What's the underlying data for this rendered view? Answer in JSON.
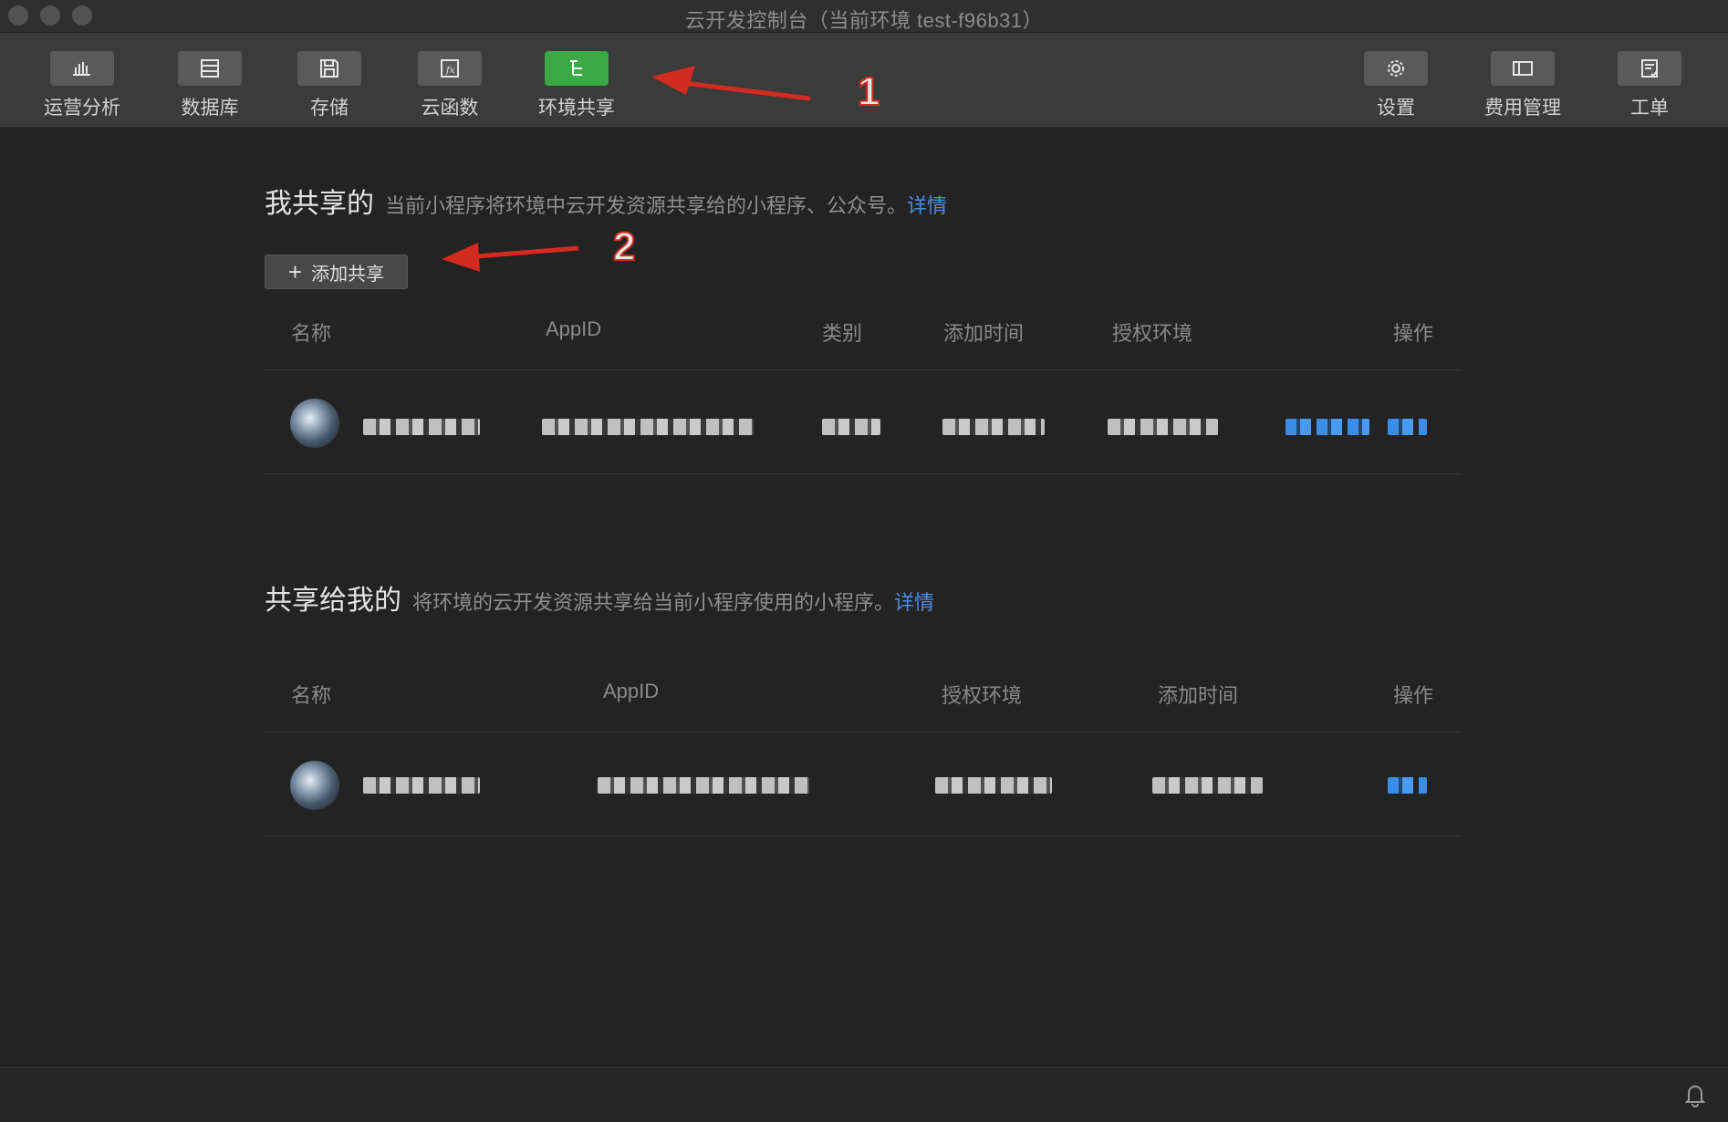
{
  "window": {
    "title": "云开发控制台（当前环境 test-f96b31）"
  },
  "toolbar": {
    "left_tools": [
      {
        "label": "运营分析",
        "icon": "bar-chart-icon",
        "active": false
      },
      {
        "label": "数据库",
        "icon": "database-icon",
        "active": false
      },
      {
        "label": "存储",
        "icon": "storage-icon",
        "active": false
      },
      {
        "label": "云函数",
        "icon": "cloud-function-icon",
        "active": false
      },
      {
        "label": "环境共享",
        "icon": "env-share-icon",
        "active": true
      }
    ],
    "right_tools": [
      {
        "label": "设置",
        "icon": "gear-icon"
      },
      {
        "label": "费用管理",
        "icon": "billing-icon"
      },
      {
        "label": "工单",
        "icon": "ticket-icon"
      }
    ],
    "active_color": "#3aa845"
  },
  "annotations": {
    "arrow1_label": "1",
    "arrow2_label": "2",
    "arrow_color": "#d32b20"
  },
  "my_shared": {
    "title": "我共享的",
    "description": "当前小程序将环境中云开发资源共享给的小程序、公众号。",
    "link": "详情",
    "add_button": "添加共享",
    "columns": [
      "名称",
      "AppID",
      "类别",
      "添加时间",
      "授权环境",
      "操作"
    ],
    "rows": [
      {
        "avatar": "blurred-avatar",
        "name": "",
        "appid": "",
        "category": "",
        "added_time": "",
        "env": "",
        "actions": ""
      }
    ]
  },
  "shared_to_me": {
    "title": "共享给我的",
    "description": "将环境的云开发资源共享给当前小程序使用的小程序。",
    "link": "详情",
    "columns": [
      "名称",
      "AppID",
      "授权环境",
      "添加时间",
      "操作"
    ],
    "rows": [
      {
        "avatar": "blurred-avatar",
        "name": "",
        "appid": "",
        "env": "",
        "added_time": "",
        "actions": ""
      }
    ]
  },
  "colors": {
    "background": "#232323",
    "link": "#4a8fe6",
    "toolbar": "#3b3b3b"
  },
  "footer": {
    "icon": "bell-icon"
  }
}
